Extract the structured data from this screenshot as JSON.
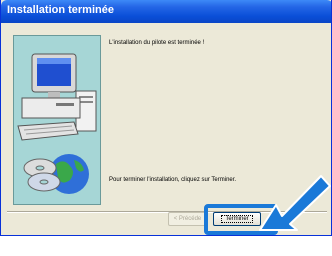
{
  "window": {
    "title": "Installation terminée"
  },
  "content": {
    "message_done": "L'installation du pilote est terminée !",
    "message_finish": "Pour terminer l'installation, cliquez sur Terminer."
  },
  "buttons": {
    "back_label": "< Précéde",
    "finish_label": "Terminer"
  },
  "colors": {
    "titlebar": "#0a4fd8",
    "dialog_bg": "#ece9d8",
    "callout": "#1a79d8",
    "image_bg": "#a6d6d6"
  }
}
